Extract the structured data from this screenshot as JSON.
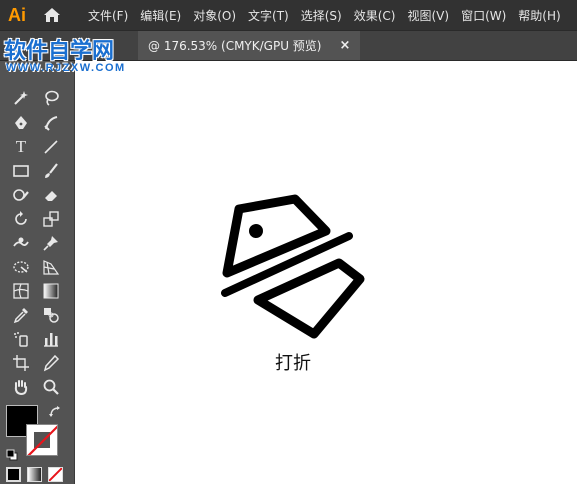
{
  "app": {
    "logo": "Ai"
  },
  "menu": {
    "items": [
      "文件(F)",
      "编辑(E)",
      "对象(O)",
      "文字(T)",
      "选择(S)",
      "效果(C)",
      "视图(V)",
      "窗口(W)",
      "帮助(H)"
    ]
  },
  "tab": {
    "title": "@ 176.53% (CMYK/GPU 预览)",
    "close": "×"
  },
  "watermark": {
    "site_name": "软件自学网",
    "url": "WWW.RJZXW.COM"
  },
  "toolbar": {
    "type_tool_glyph": "T",
    "fill_color": "#000000",
    "stroke_color": "none"
  },
  "canvas": {
    "caption": "打折"
  }
}
